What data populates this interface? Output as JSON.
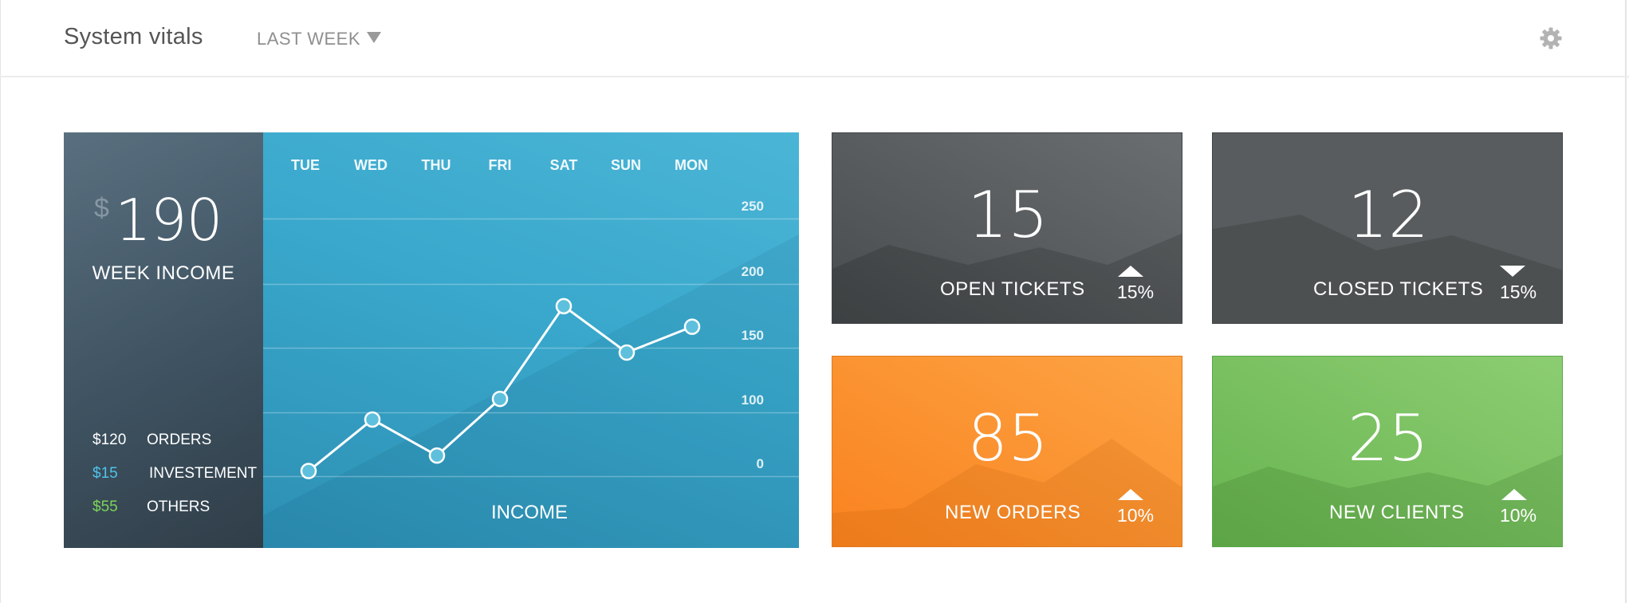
{
  "header": {
    "title": "System vitals",
    "range_label": "LAST WEEK",
    "settings_icon": "gear-icon"
  },
  "income": {
    "currency": "$",
    "amount": "190",
    "label": "WEEK INCOME",
    "breakdown": [
      {
        "value": "$120",
        "label": "ORDERS",
        "color": "#ffffff"
      },
      {
        "value": "$15",
        "label": "INVESTEMENT",
        "color": "#4fc3ea"
      },
      {
        "value": "$55",
        "label": "OTHERS",
        "color": "#7dd35a"
      }
    ]
  },
  "chart_data": {
    "type": "line",
    "categories": [
      "TUE",
      "WED",
      "THU",
      "FRI",
      "SAT",
      "SUN",
      "MON"
    ],
    "series": [
      {
        "values": [
          5,
          55,
          20,
          75,
          165,
          120,
          145
        ]
      }
    ],
    "yticks": [
      "250",
      "200",
      "150",
      "100",
      "0"
    ],
    "xlabel": "INCOME",
    "ylim": [
      0,
      250
    ],
    "grid": true
  },
  "tiles": [
    {
      "value": "15",
      "label": "OPEN TICKETS",
      "change": "15%",
      "direction": "up",
      "color": "#555a5c"
    },
    {
      "value": "12",
      "label": "CLOSED TICKETS",
      "change": "15%",
      "direction": "down",
      "color": "#595c5e"
    },
    {
      "value": "85",
      "label": "NEW ORDERS",
      "change": "10%",
      "direction": "up",
      "color": "#fa8f2c"
    },
    {
      "value": "25",
      "label": "NEW CLIENTS",
      "change": "10%",
      "direction": "up",
      "color": "#6fbb5a"
    }
  ]
}
